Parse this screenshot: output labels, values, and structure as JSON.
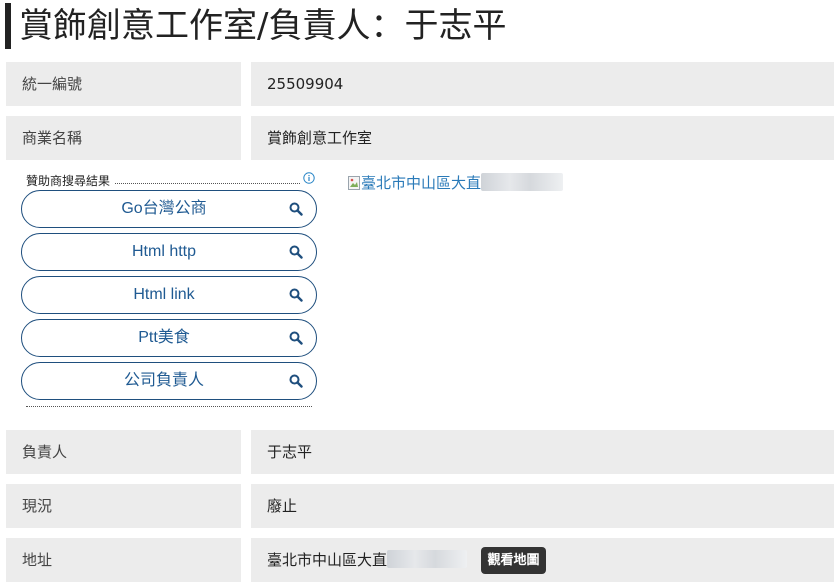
{
  "header": {
    "title": "賞飾創意工作室/負責人：于志平"
  },
  "fields": {
    "tax_id": {
      "label": "統一編號",
      "value": "25509904"
    },
    "business_name": {
      "label": "商業名稱",
      "value": "賞飾創意工作室"
    },
    "representative": {
      "label": "負責人",
      "value": "于志平"
    },
    "status": {
      "label": "現況",
      "value": "廢止"
    },
    "address": {
      "label": "地址",
      "value": "臺北市中山區大直",
      "map_button": "觀看地圖"
    }
  },
  "sponsored_search": {
    "title": "贊助商搜尋結果",
    "info_icon": "info-circle-icon",
    "items": [
      {
        "label": "Go台灣公商",
        "icon": "search-icon"
      },
      {
        "label": "Html http",
        "icon": "search-icon"
      },
      {
        "label": "Html link",
        "icon": "search-icon"
      },
      {
        "label": "Ptt美食",
        "icon": "search-icon"
      },
      {
        "label": "公司負責人",
        "icon": "search-icon"
      }
    ]
  },
  "map_image": {
    "alt_text": "臺北市中山區大直",
    "icon": "broken-image-icon"
  },
  "colors": {
    "label_bg": "#ececec",
    "pill_border": "#1f4f7e",
    "pill_text": "#1f5a92",
    "link": "#2a7ab8",
    "map_button_bg": "#333333"
  }
}
